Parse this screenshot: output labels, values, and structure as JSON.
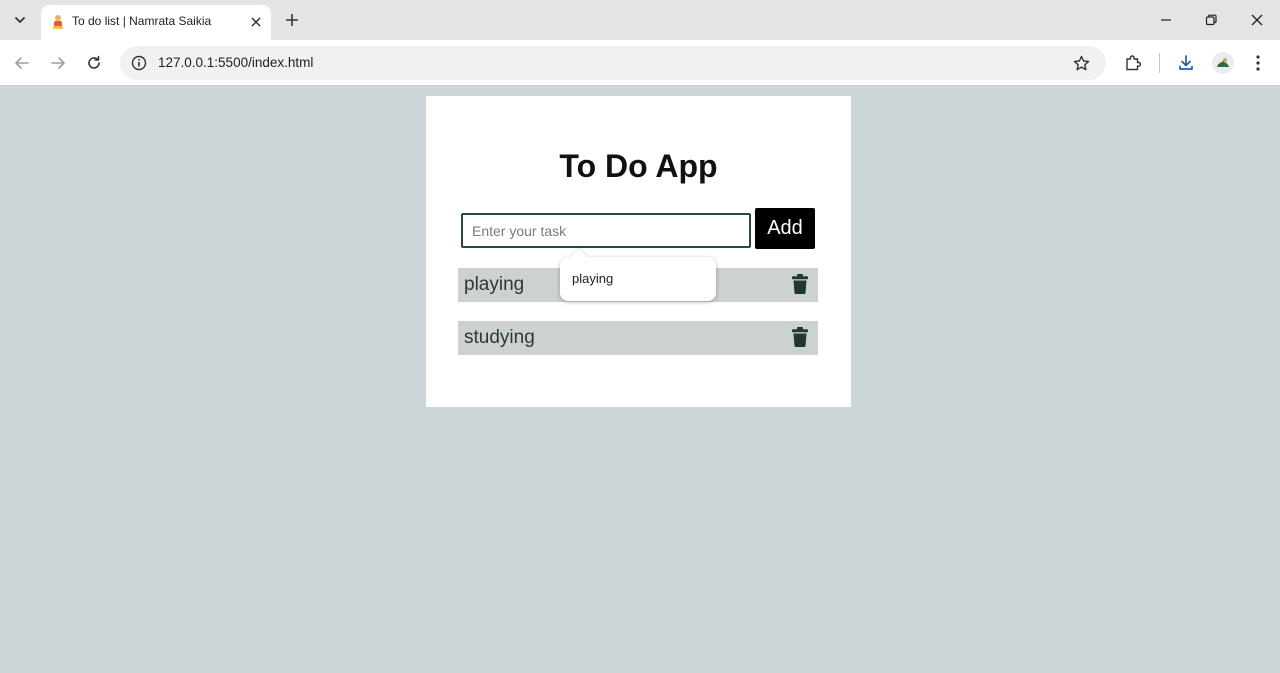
{
  "browser": {
    "tab_title": "To do list | Namrata Saikia",
    "url": "127.0.0.1:5500/index.html"
  },
  "app": {
    "title": "To Do App",
    "input": {
      "value": "",
      "placeholder": "Enter your task"
    },
    "add_label": "Add",
    "tasks": [
      {
        "text": "playing"
      },
      {
        "text": "studying"
      }
    ],
    "autocomplete": {
      "suggestion": "playing"
    }
  },
  "colors": {
    "page_background": "#cdd6d8",
    "card_background": "#ffffff",
    "task_background": "#cbd2cf",
    "accent_dark": "#274a3a",
    "button_background": "#000000"
  },
  "icons": {
    "tab_search": "chevron-down-icon",
    "favicon": "app-favicon",
    "tab_close": "close-icon",
    "new_tab": "plus-icon",
    "back": "arrow-left-icon",
    "forward": "arrow-right-icon",
    "reload": "reload-icon",
    "site_info": "info-icon",
    "bookmark": "star-icon",
    "extensions": "puzzle-icon",
    "downloads": "download-icon",
    "menu": "kebab-menu-icon",
    "delete": "trash-icon"
  }
}
